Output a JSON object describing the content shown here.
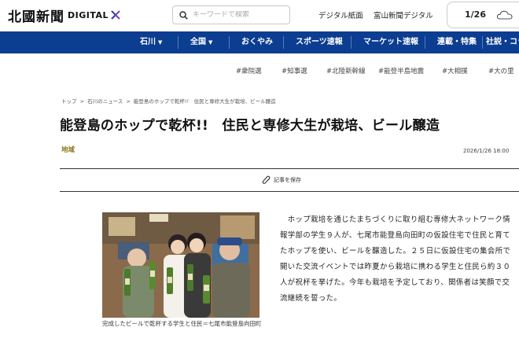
{
  "header": {
    "logo_jp": "北國新聞",
    "logo_digital": "DIGITAL",
    "search_placeholder": "キーワードで検索",
    "link_digital_paper": "デジタル紙面",
    "link_toyama": "富山新聞デジタル",
    "date": "1/26"
  },
  "nav": {
    "items": [
      {
        "label": "石川",
        "has_caret": true
      },
      {
        "label": "全国",
        "has_caret": true
      },
      {
        "label": "おくやみ"
      },
      {
        "label": "スポーツ速報"
      },
      {
        "label": "マーケット速報"
      },
      {
        "label": "連載・特集"
      },
      {
        "label": "社説・コラ"
      }
    ]
  },
  "hashtags": [
    "#衆院選",
    "#知事選",
    "#北陸新幹線",
    "#能登半島地震",
    "#大相撲",
    "#大の里"
  ],
  "breadcrumb": [
    "トップ",
    "石川のニュース",
    "能登島のホップで乾杯!!　住民と専修大生が栽培、ビール醸造"
  ],
  "article": {
    "title": "能登島のホップで乾杯!!　住民と専修大生が栽培、ビール醸造",
    "category": "地域",
    "published": "2026/1/26 18:00",
    "save_label": "記事を保存",
    "caption": "完成したビールで乾杯する学生と住民＝七尾市能登島向田町",
    "body": "　ホップ栽培を通じたまちづくりに取り組む専修大ネットワーク情報学部の学生９人が、七尾市能登島向田町の仮設住宅で住民と育てたホップを使い、ビールを醸造した。２５日に仮設住宅の集会所で開いた交流イベントでは昨夏から栽培に携わる学生と住民ら約３０人が祝杯を挙げた。今年も栽培を予定しており、関係者は笑顔で交流継続を誓った。"
  },
  "colors": {
    "nav_bg": "#0b3d91",
    "category": "#8a7a1a"
  }
}
